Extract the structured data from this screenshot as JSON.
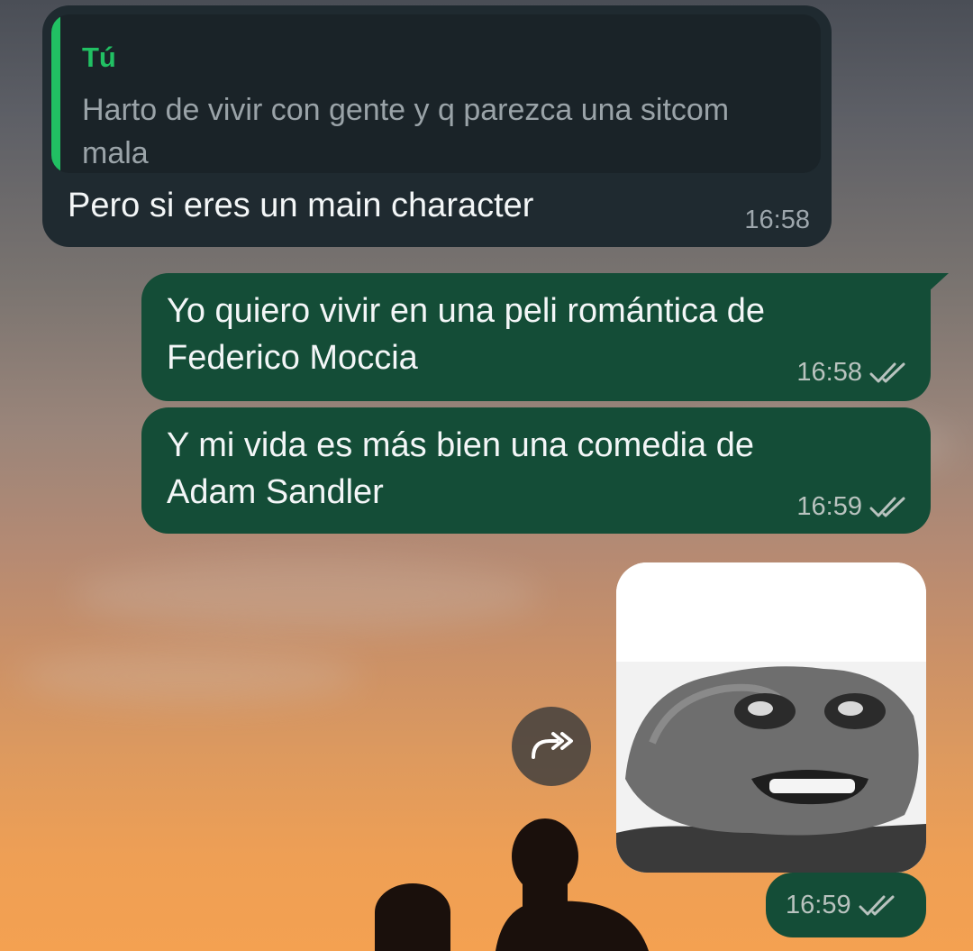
{
  "messages": [
    {
      "direction": "incoming",
      "quote": {
        "author": "Tú",
        "text": "Harto de vivir con gente y q parezca una sitcom mala"
      },
      "text": "Pero si eres un main character",
      "time": "16:58"
    },
    {
      "direction": "outgoing",
      "text_lines": [
        "Yo quiero vivir en una peli romántica de",
        "Federico Moccia"
      ],
      "time": "16:58",
      "status": "read"
    },
    {
      "direction": "outgoing",
      "text_lines": [
        "Y mi vida es más bien una comedia de",
        "Adam Sandler"
      ],
      "time": "16:59",
      "status": "read"
    },
    {
      "direction": "outgoing",
      "type": "sticker",
      "sticker_icon": "pepe-frog-grimace-sticker",
      "time": "16:59",
      "status": "read"
    }
  ],
  "icons": {
    "forward": "forward-icon",
    "read_ticks": "double-check-icon"
  },
  "colors": {
    "incoming_bubble": "#1f2a30",
    "outgoing_bubble": "#144d37",
    "quote_accent": "#21c063",
    "read_ticks": "#b9c3bf"
  }
}
